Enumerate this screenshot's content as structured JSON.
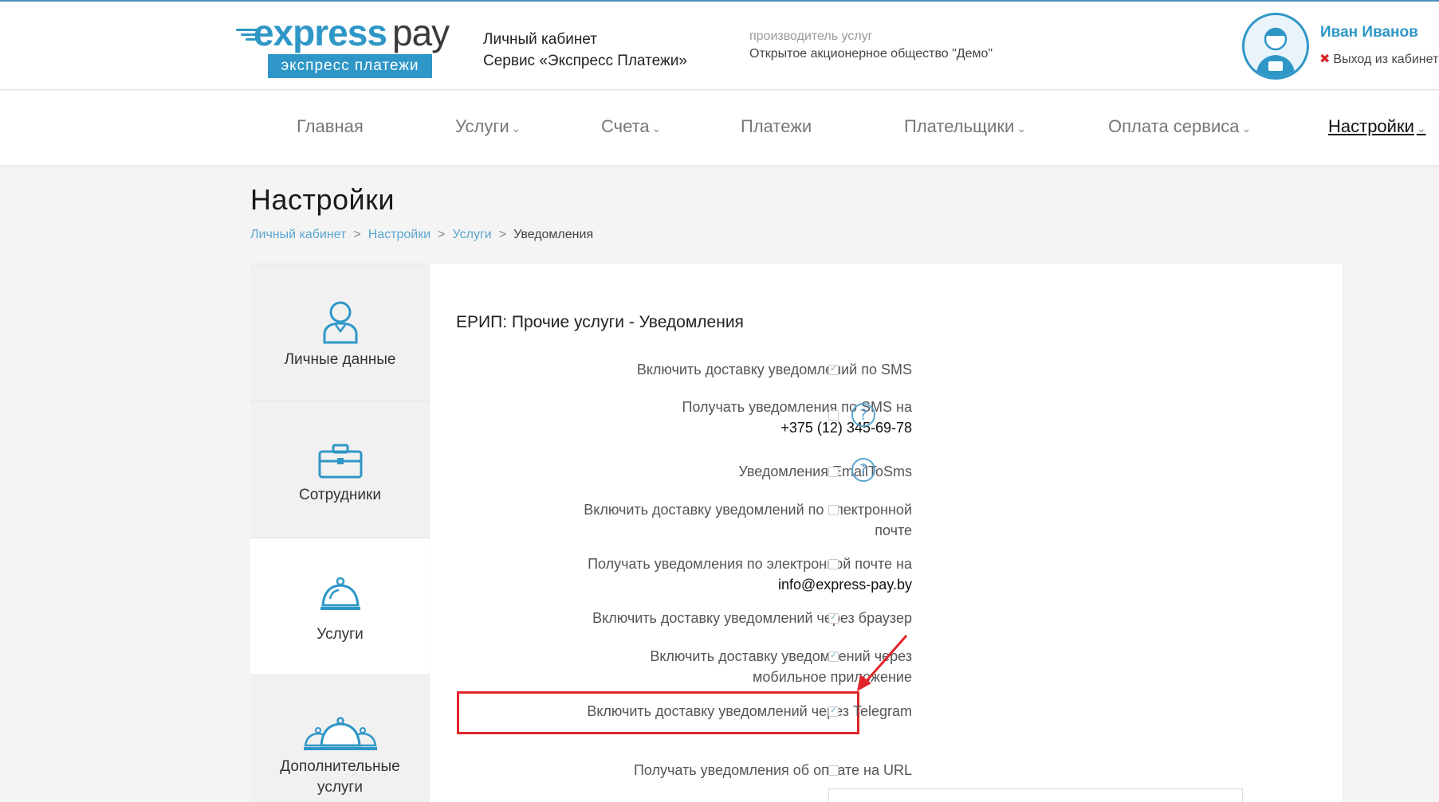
{
  "header": {
    "logo": {
      "express": "express",
      "pay": "pay",
      "subtitle": "экспресс платежи"
    },
    "cabinet_line1": "Личный кабинет",
    "cabinet_line2": "Сервис «Экспресс Платежи»",
    "provider_label": "производитель услуг",
    "provider_name": "Открытое акционерное общество \"Демо\"",
    "user_name": "Иван Иванов",
    "logout_label": "Выход из кабинета"
  },
  "nav": {
    "items": [
      {
        "label": "Главная",
        "dropdown": false
      },
      {
        "label": "Услуги",
        "dropdown": true
      },
      {
        "label": "Счета",
        "dropdown": true
      },
      {
        "label": "Платежи",
        "dropdown": false
      },
      {
        "label": "Плательщики",
        "dropdown": true
      },
      {
        "label": "Оплата сервиса",
        "dropdown": true
      },
      {
        "label": "Настройки",
        "dropdown": true,
        "active": true
      }
    ],
    "caret": "⌄"
  },
  "page": {
    "title": "Настройки",
    "breadcrumb": [
      "Личный кабинет",
      "Настройки",
      "Услуги",
      "Уведомления"
    ],
    "breadcrumb_sep": ">"
  },
  "sidebar": {
    "items": [
      {
        "label": "Личные данные",
        "icon": "user-icon"
      },
      {
        "label": "Сотрудники",
        "icon": "briefcase-icon"
      },
      {
        "label": "Услуги",
        "icon": "service-bell-icon",
        "active": true
      },
      {
        "label_line1": "Дополнительные",
        "label_line2": "услуги",
        "icon": "service-bells-icon"
      }
    ]
  },
  "panel": {
    "title": "ЕРИП: Прочие услуги - Уведомления",
    "rows": [
      {
        "label": "Включить доставку уведомлений по SMS",
        "checked": true
      },
      {
        "label": "Получать уведомления по SMS на",
        "value": "+375 (12) 345-69-78",
        "checked": false,
        "help": true
      },
      {
        "label": "Уведомления EmailToSms",
        "checked": false,
        "help": true
      },
      {
        "label_line1": "Включить доставку уведомлений по электронной",
        "label_line2": "почте",
        "checked": false
      },
      {
        "label": "Получать уведомления по электронной почте на",
        "value": "info@express-pay.by",
        "checked": false
      },
      {
        "label": "Включить доставку уведомлений через браузер",
        "checked": true
      },
      {
        "label_line1": "Включить доставку уведомлений через",
        "label_line2": "мобильное приложение",
        "checked": true
      },
      {
        "label": "Включить доставку уведомлений через Telegram",
        "checked": true,
        "highlighted": true
      },
      {
        "label": "Получать уведомления об оплате на URL",
        "checked": false
      }
    ],
    "help_glyph": "?"
  },
  "colors": {
    "brand": "#2f97c7",
    "highlight": "#e0252b",
    "logout_x": "#d9262b"
  }
}
